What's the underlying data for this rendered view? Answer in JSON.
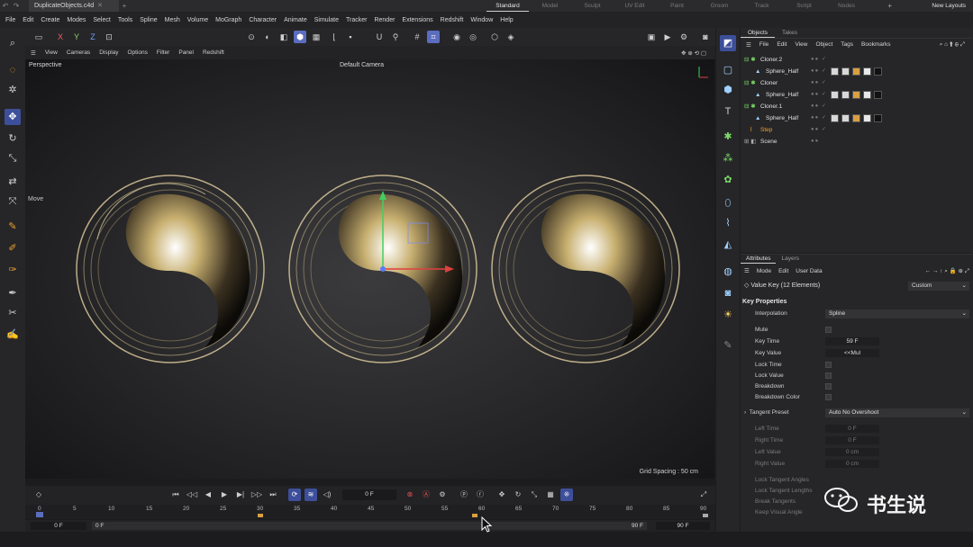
{
  "window": {
    "document_tab": "DuplicateObjects.c4d",
    "layouts": [
      "Standard",
      "Model",
      "Sculpt",
      "UV Edit",
      "Paint",
      "Groom",
      "Track",
      "Script",
      "Nodes"
    ],
    "active_layout": "Standard",
    "new_layouts": "New Layouts"
  },
  "menubar": [
    "File",
    "Edit",
    "Create",
    "Modes",
    "Select",
    "Tools",
    "Spline",
    "Mesh",
    "Volume",
    "MoGraph",
    "Character",
    "Animate",
    "Simulate",
    "Tracker",
    "Render",
    "Extensions",
    "Redshift",
    "Window",
    "Help"
  ],
  "toolbar": {
    "axis_x": "X",
    "axis_y": "Y",
    "axis_z": "Z"
  },
  "viewport": {
    "menu": [
      "View",
      "Cameras",
      "Display",
      "Options",
      "Filter",
      "Panel",
      "Redshift"
    ],
    "label": "Perspective",
    "camera": "Default Camera",
    "tool": "Move",
    "grid_spacing": "Grid Spacing : 50 cm"
  },
  "objects_panel": {
    "tabs": [
      "Objects",
      "Takes"
    ],
    "menu": [
      "File",
      "Edit",
      "View",
      "Object",
      "Tags",
      "Bookmarks"
    ],
    "rows": [
      {
        "name": "Cloner.2",
        "indent": 0
      },
      {
        "name": "Sphere_Half",
        "indent": 1
      },
      {
        "name": "Cloner",
        "indent": 0
      },
      {
        "name": "Sphere_Half",
        "indent": 1
      },
      {
        "name": "Cloner.1",
        "indent": 0
      },
      {
        "name": "Sphere_Half",
        "indent": 1
      },
      {
        "name": "Step",
        "indent": 0
      },
      {
        "name": "Scene",
        "indent": 0
      }
    ]
  },
  "attributes": {
    "tabs": [
      "Attributes",
      "Layers"
    ],
    "menu": [
      "Mode",
      "Edit",
      "User Data"
    ],
    "header": "Value Key (12 Elements)",
    "preset": "Custom",
    "section": "Key Properties",
    "interpolation_label": "Interpolation",
    "interpolation_value": "Spline",
    "mute": "Mute",
    "key_time_label": "Key Time",
    "key_time_value": "59 F",
    "key_value_label": "Key Value",
    "key_value_value": "<<Mul",
    "lock_time": "Lock Time",
    "lock_value": "Lock Value",
    "breakdown": "Breakdown",
    "breakdown_color": "Breakdown Color",
    "tangent_preset_label": "Tangent Preset",
    "tangent_preset_value": "Auto No Overshoot",
    "left_time": "Left Time",
    "left_time_value": "0 F",
    "right_time": "Right Time",
    "right_time_value": "0 F",
    "left_value": "Left Value",
    "left_value_value": "0 cm",
    "right_value": "Right Value",
    "right_value_value": "0 cm",
    "lock_tangent_angles": "Lock Tangent Angles",
    "lock_tangent_lengths": "Lock Tangent Lengths",
    "break_tangents": "Break Tangents",
    "keep_visual_angle": "Keep Visual Angle"
  },
  "timeline": {
    "current_frame": "0 F",
    "ruler": [
      "0",
      "5",
      "10",
      "15",
      "20",
      "25",
      "30",
      "35",
      "40",
      "45",
      "50",
      "55",
      "60",
      "65",
      "70",
      "75",
      "80",
      "85",
      "90"
    ],
    "start_frame": "0 F",
    "range_start": "0 F",
    "range_end": "90 F",
    "end_frame": "90 F"
  },
  "watermark": "书生说"
}
